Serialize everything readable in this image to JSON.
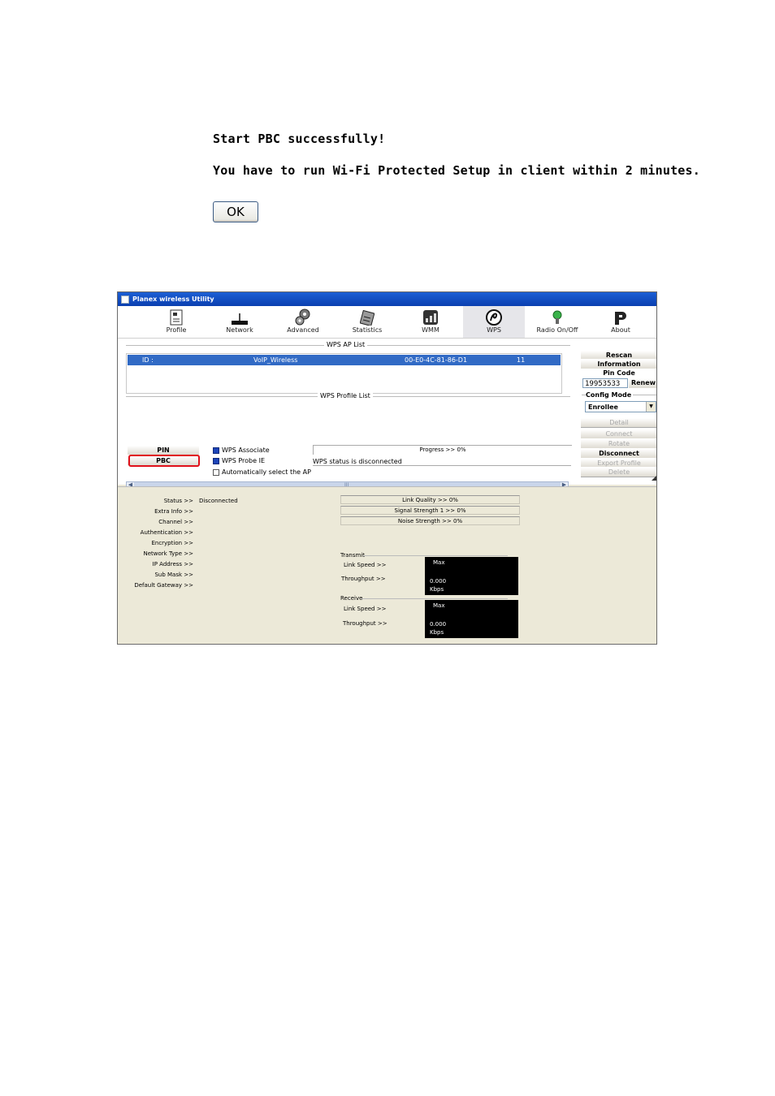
{
  "dialog": {
    "line1": "Start PBC successfully!",
    "line2": "You have to run Wi-Fi Protected Setup in client within 2 minutes.",
    "ok_label": "OK"
  },
  "window": {
    "title": "Planex wireless Utility",
    "toolbar": [
      {
        "label": "Profile",
        "icon": "profile-icon"
      },
      {
        "label": "Network",
        "icon": "network-icon"
      },
      {
        "label": "Advanced",
        "icon": "advanced-icon"
      },
      {
        "label": "Statistics",
        "icon": "statistics-icon"
      },
      {
        "label": "WMM",
        "icon": "wmm-icon"
      },
      {
        "label": "WPS",
        "icon": "wps-icon",
        "active": true
      },
      {
        "label": "Radio On/Off",
        "icon": "radio-icon"
      },
      {
        "label": "About",
        "icon": "about-icon"
      }
    ],
    "wps": {
      "ap_list_title": "WPS AP List",
      "ap_row": {
        "id_label": "ID :",
        "ssid": "VoIP_Wireless",
        "bssid": "00-E0-4C-81-86-D1",
        "channel": "11"
      },
      "profile_list_title": "WPS Profile List",
      "scroll_thumb": "III",
      "side": {
        "rescan": "Rescan",
        "information": "Information",
        "pin_code_label": "Pin Code",
        "pin_code": "19953533",
        "renew": "Renew",
        "config_mode_label": "Config Mode",
        "config_mode": "Enrollee",
        "detail": "Detail",
        "connect": "Connect",
        "rotate": "Rotate",
        "disconnect": "Disconnect",
        "export_profile": "Export Profile",
        "delete": "Delete"
      },
      "pin_button": "PIN",
      "pbc_button": "PBC",
      "wps_associate": "WPS Associate",
      "wps_probe_ie": "WPS Probe IE",
      "auto_select": "Automatically select the AP",
      "progress": "Progress >> 0%",
      "status": "WPS status is disconnected"
    },
    "status": {
      "labels": [
        "Status >>",
        "Extra Info >>",
        "Channel >>",
        "Authentication >>",
        "Encryption >>",
        "Network Type >>",
        "IP Address >>",
        "Sub Mask >>",
        "Default Gateway >>"
      ],
      "status_value": "Disconnected",
      "link_quality": "Link Quality >> 0%",
      "signal_strength": "Signal Strength 1 >> 0%",
      "noise_strength": "Noise Strength >> 0%",
      "transmit": {
        "title": "Transmit",
        "link_speed": "Link Speed >>",
        "throughput": "Throughput >>",
        "max": "Max",
        "value": "0.000",
        "unit": "Kbps"
      },
      "receive": {
        "title": "Receive",
        "link_speed": "Link Speed >>",
        "throughput": "Throughput >>",
        "max": "Max",
        "value": "0.000",
        "unit": "Kbps"
      }
    }
  }
}
